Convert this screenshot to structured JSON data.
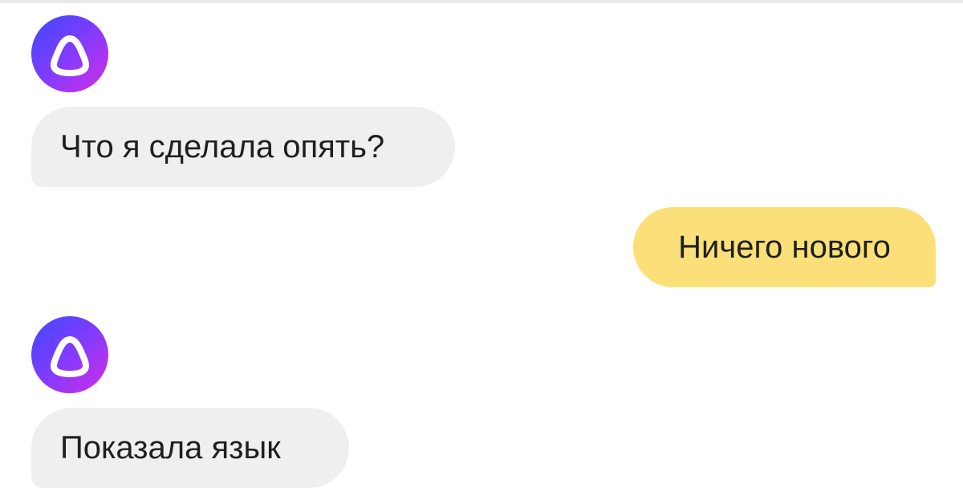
{
  "chat": {
    "messages": [
      {
        "sender": "assistant",
        "text": "Что я сделала опять?",
        "avatar_icon": "alice-logo-icon"
      },
      {
        "sender": "user",
        "text": "Ничего нового"
      },
      {
        "sender": "assistant",
        "text": "Показала язык",
        "avatar_icon": "alice-logo-icon"
      }
    ]
  },
  "colors": {
    "incoming_bubble": "#efefef",
    "outgoing_bubble": "#fbe079",
    "avatar_gradient": [
      "#3c4bff",
      "#7a3cff",
      "#d22ee6"
    ],
    "text": "#1f1f1f"
  }
}
